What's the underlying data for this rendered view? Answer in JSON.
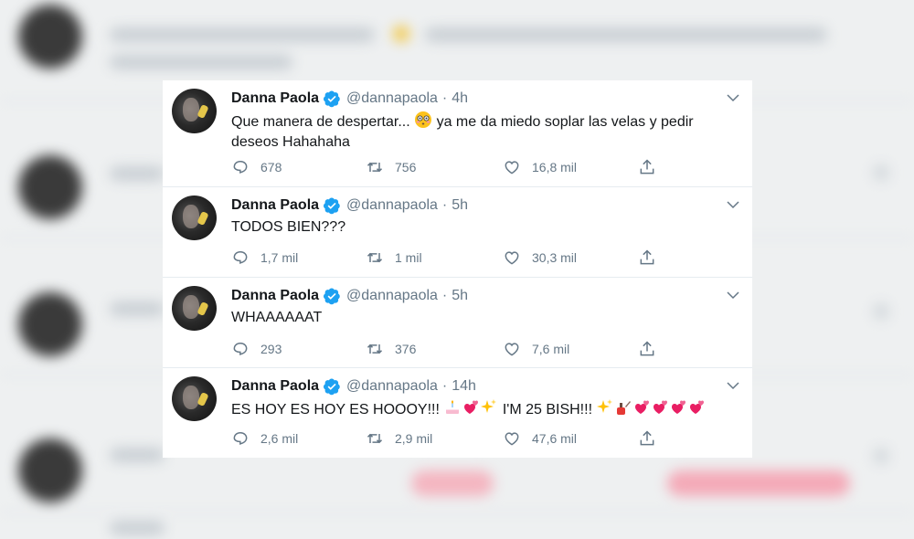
{
  "tweets": [
    {
      "name": "Danna Paola",
      "handle": "@dannapaola",
      "separator": "·",
      "time": "4h",
      "text_line1": "Que manera de despertar...",
      "text_line1_b": " ya me da miedo soplar las velas y pedir",
      "text_line2": "deseos Hahahaha",
      "emoji": "flushed-face",
      "replies": "678",
      "retweets": "756",
      "likes": "16,8 mil"
    },
    {
      "name": "Danna Paola",
      "handle": "@dannapaola",
      "separator": "·",
      "time": "5h",
      "text_line1": "TODOS BIEN???",
      "replies": "1,7 mil",
      "retweets": "1 mil",
      "likes": "30,3 mil"
    },
    {
      "name": "Danna Paola",
      "handle": "@dannapaola",
      "separator": "·",
      "time": "5h",
      "text_line1": "WHAAAAAAT",
      "replies": "293",
      "retweets": "376",
      "likes": "7,6 mil"
    },
    {
      "name": "Danna Paola",
      "handle": "@dannapaola",
      "separator": "·",
      "time": "14h",
      "text_a": "ES HOY ES HOY ES HOOOY!!! ",
      "text_b": " I'M 25 BISH!!! ",
      "emojis": [
        "birthday-cake",
        "two-hearts",
        "sparkles",
        "sparkles",
        "nail-polish",
        "two-hearts",
        "two-hearts",
        "two-hearts",
        "two-hearts"
      ],
      "replies": "2,6 mil",
      "retweets": "2,9 mil",
      "likes": "47,6 mil"
    }
  ],
  "colors": {
    "verified": "#1da1f2",
    "text": "#14171a",
    "muted": "#657786",
    "divider": "#e6ecf0"
  }
}
